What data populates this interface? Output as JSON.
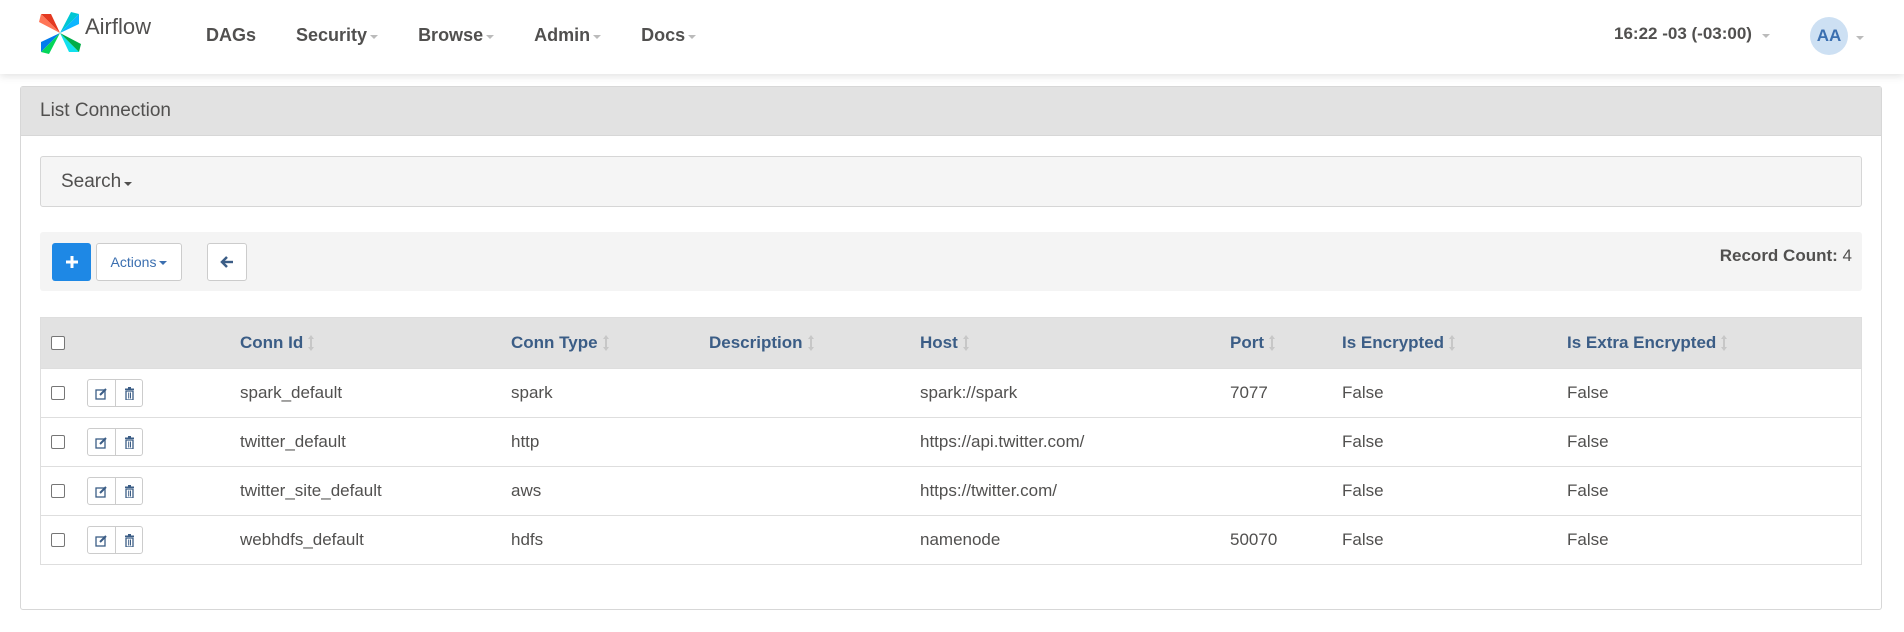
{
  "navbar": {
    "brand": "Airflow",
    "items": [
      {
        "label": "DAGs",
        "has_dropdown": false
      },
      {
        "label": "Security",
        "has_dropdown": true
      },
      {
        "label": "Browse",
        "has_dropdown": true
      },
      {
        "label": "Admin",
        "has_dropdown": true
      },
      {
        "label": "Docs",
        "has_dropdown": true
      }
    ],
    "clock": "16:22 -03 (-03:00)",
    "user_initials": "AA"
  },
  "panel": {
    "title": "List Connection",
    "search_label": "Search",
    "toolbar": {
      "add_icon": "plus-icon",
      "actions_label": "Actions",
      "back_icon": "arrow-left-icon",
      "record_count_label": "Record Count:",
      "record_count_value": "4"
    }
  },
  "table": {
    "columns": [
      {
        "key": "conn_id",
        "label": "Conn Id"
      },
      {
        "key": "conn_type",
        "label": "Conn Type"
      },
      {
        "key": "description",
        "label": "Description"
      },
      {
        "key": "host",
        "label": "Host"
      },
      {
        "key": "port",
        "label": "Port"
      },
      {
        "key": "is_encrypted",
        "label": "Is Encrypted"
      },
      {
        "key": "is_extra_encrypted",
        "label": "Is Extra Encrypted"
      }
    ],
    "rows": [
      {
        "conn_id": "spark_default",
        "conn_type": "spark",
        "description": "",
        "host": "spark://spark",
        "port": "7077",
        "is_encrypted": "False",
        "is_extra_encrypted": "False"
      },
      {
        "conn_id": "twitter_default",
        "conn_type": "http",
        "description": "",
        "host": "https://api.twitter.com/",
        "port": "",
        "is_encrypted": "False",
        "is_extra_encrypted": "False"
      },
      {
        "conn_id": "twitter_site_default",
        "conn_type": "aws",
        "description": "",
        "host": "https://twitter.com/",
        "port": "",
        "is_encrypted": "False",
        "is_extra_encrypted": "False"
      },
      {
        "conn_id": "webhdfs_default",
        "conn_type": "hdfs",
        "description": "",
        "host": "namenode",
        "port": "50070",
        "is_encrypted": "False",
        "is_extra_encrypted": "False"
      }
    ]
  },
  "colors": {
    "primary": "#1e88e5",
    "header_bg": "#e2e2e2",
    "link": "#3b5d86",
    "text": "#51504f"
  }
}
